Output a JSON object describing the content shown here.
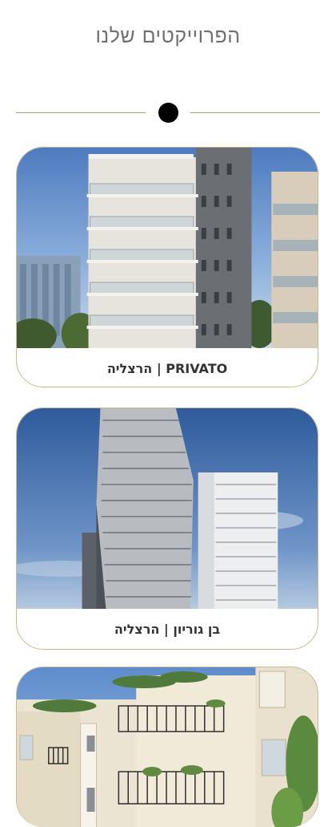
{
  "section": {
    "title": "הפרוייקטים שלנו"
  },
  "projects": [
    {
      "label": "PRIVATO | הרצליה",
      "image": "building-photo"
    },
    {
      "label": "בן גוריון | הרצליה",
      "image": "tower-photo"
    },
    {
      "label": "",
      "image": "building-photo"
    }
  ],
  "colors": {
    "accent": "#b8a272",
    "title": "#6f6f6f",
    "caption": "#333333"
  }
}
